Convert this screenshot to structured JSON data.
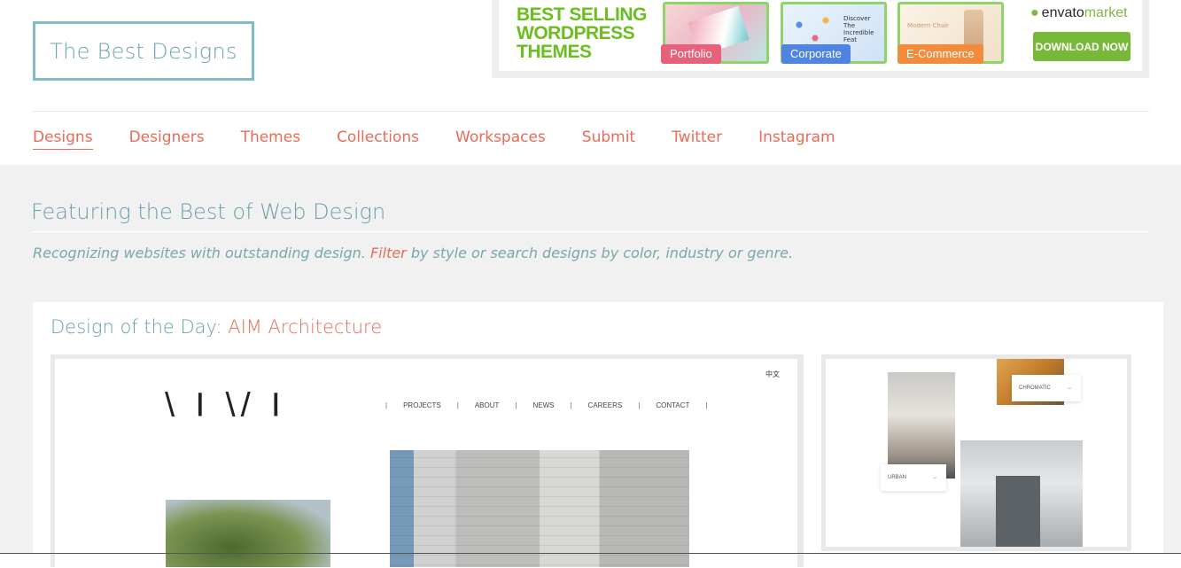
{
  "site": {
    "logo": "The Best Designs"
  },
  "ad": {
    "headline_line1": "BEST SELLING",
    "headline_line2": "WORDPRESS",
    "headline_line3": "THEMES",
    "tags": [
      "Portfolio",
      "Corporate",
      "E-Commerce"
    ],
    "card2_text": "Discover The Incredible Feat",
    "card3_text": "Modern Chair",
    "brand_prefix": "envato",
    "brand_suffix": "market",
    "cta": "DOWNLOAD NOW"
  },
  "nav": {
    "items": [
      "Designs",
      "Designers",
      "Themes",
      "Collections",
      "Workspaces",
      "Submit",
      "Twitter",
      "Instagram"
    ],
    "active": "Designs"
  },
  "hero": {
    "title": "Featuring the Best of Web Design",
    "subtitle_before": "Recognizing websites with outstanding design. ",
    "subtitle_link": "Filter",
    "subtitle_after": " by style or search designs by color, industry or genre."
  },
  "dotd": {
    "label": "Design of the Day: ",
    "name": "AIM Architecture",
    "screenshot": {
      "logo": "\\ I \\/ I",
      "lang": "中文",
      "nav": [
        "PROJECTS",
        "ABOUT",
        "NEWS",
        "CAREERS",
        "CONTACT"
      ],
      "side_labels": [
        "CHROMATIC",
        "URBAN"
      ],
      "arrow": "→"
    }
  },
  "colors": {
    "accent": "#e86b57",
    "teal": "#6aa0aa",
    "logo_border": "#7fbcc3",
    "envato_green": "#78b838"
  }
}
